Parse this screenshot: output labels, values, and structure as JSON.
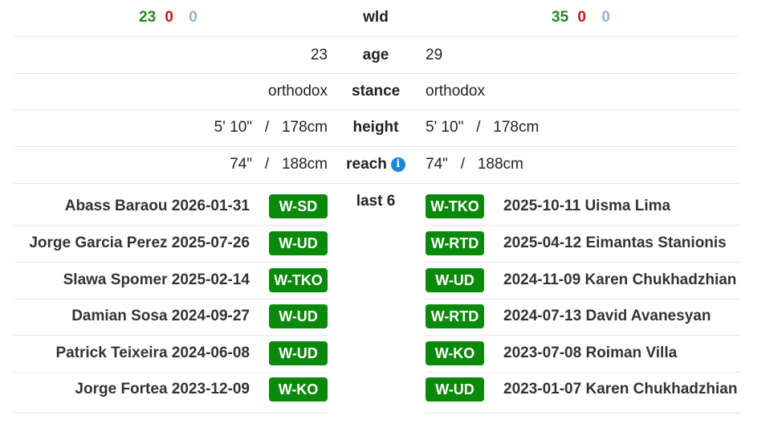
{
  "wld_row": {
    "label": "wld",
    "left": {
      "wins": "23",
      "losses": "0",
      "draws": "0"
    },
    "right": {
      "wins": "35",
      "losses": "0",
      "draws": "0"
    }
  },
  "stats": {
    "age": {
      "label": "age",
      "left": "23",
      "right": "29"
    },
    "stance": {
      "label": "stance",
      "left": "orthodox",
      "right": "orthodox"
    },
    "height": {
      "label": "height",
      "left": "5' 10\"   /   178cm",
      "right": "5' 10\"   /   178cm"
    },
    "reach": {
      "label": "reach",
      "left": "74\"   /   188cm",
      "right": "74\"   /   188cm",
      "icon": "info-icon"
    }
  },
  "last6_label": "last 6",
  "colors": {
    "win_badge": "#0a8a0a",
    "wins": "#1e8a1e",
    "losses": "#cc1111",
    "draws": "#8fb3e0",
    "info": "#1b87d6"
  },
  "fights_left": [
    {
      "opponent": "Abass Baraou",
      "date": "2026-01-31",
      "result": "W-SD"
    },
    {
      "opponent": "Jorge Garcia Perez",
      "date": "2025-07-26",
      "result": "W-UD"
    },
    {
      "opponent": "Slawa Spomer",
      "date": "2025-02-14",
      "result": "W-TKO"
    },
    {
      "opponent": "Damian Sosa",
      "date": "2024-09-27",
      "result": "W-UD"
    },
    {
      "opponent": "Patrick Teixeira",
      "date": "2024-06-08",
      "result": "W-UD"
    },
    {
      "opponent": "Jorge Fortea",
      "date": "2023-12-09",
      "result": "W-KO"
    }
  ],
  "fights_right": [
    {
      "opponent": "Uisma Lima",
      "date": "2025-10-11",
      "result": "W-TKO"
    },
    {
      "opponent": "Eimantas Stanionis",
      "date": "2025-04-12",
      "result": "W-RTD"
    },
    {
      "opponent": "Karen Chukhadzhian",
      "date": "2024-11-09",
      "result": "W-UD"
    },
    {
      "opponent": "David Avanesyan",
      "date": "2024-07-13",
      "result": "W-RTD"
    },
    {
      "opponent": "Roiman Villa",
      "date": "2023-07-08",
      "result": "W-KO"
    },
    {
      "opponent": "Karen Chukhadzhian",
      "date": "2023-01-07",
      "result": "W-UD"
    }
  ]
}
